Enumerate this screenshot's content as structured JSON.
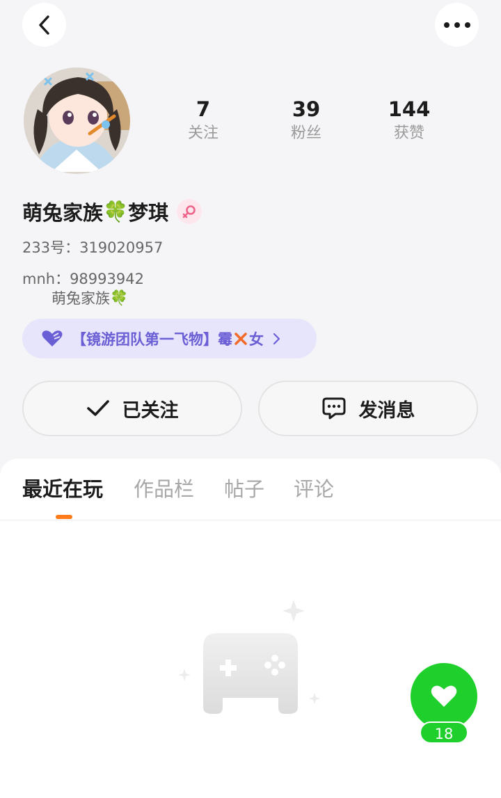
{
  "header": {
    "back_icon": "chevron-left-icon",
    "more_icon": "more-horizontal-icon"
  },
  "profile": {
    "nickname_part1": "萌兔家族",
    "nickname_emoji": "🍀",
    "nickname_part2": "梦琪",
    "gender_icon": "female-icon",
    "id_line": "233号：319020957",
    "bio_line1": "mnh：98993942",
    "bio_line2": "萌兔家族"
  },
  "stats": [
    {
      "value": "7",
      "label": "关注"
    },
    {
      "value": "39",
      "label": "粉丝"
    },
    {
      "value": "144",
      "label": "获赞"
    }
  ],
  "club": {
    "text_prefix": "【镜游团队第一飞物】霉",
    "text_suffix": "女"
  },
  "actions": {
    "follow_label": "已关注",
    "message_label": "发消息"
  },
  "tabs": [
    "最近在玩",
    "作品栏",
    "帖子",
    "评论"
  ],
  "fab": {
    "count": "18"
  },
  "colors": {
    "accent": "#ff7a1a",
    "fab": "#1fd02c",
    "club_text": "#6b5fd6",
    "club_bg": "#e7e5fb"
  }
}
